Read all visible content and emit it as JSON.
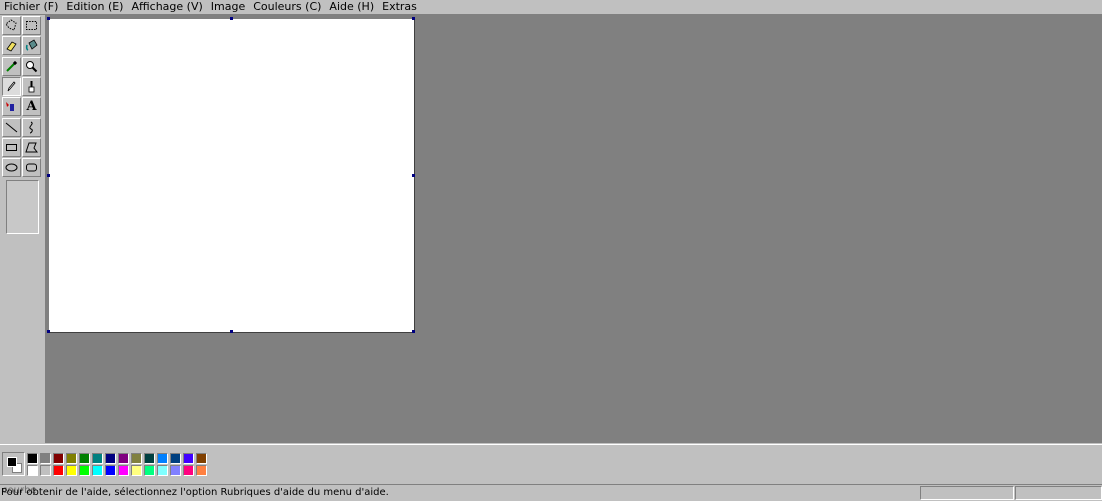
{
  "menu": [
    {
      "name": "file",
      "label": "Fichier",
      "key": "(F)"
    },
    {
      "name": "edit",
      "label": "Edition",
      "key": "(E)"
    },
    {
      "name": "view",
      "label": "Affichage",
      "key": "(V)"
    },
    {
      "name": "image",
      "label": "Image",
      "key": ""
    },
    {
      "name": "colors",
      "label": "Couleurs",
      "key": "(C)"
    },
    {
      "name": "help",
      "label": "Aide",
      "key": "(H)"
    },
    {
      "name": "extras",
      "label": "Extras",
      "key": ""
    }
  ],
  "tools": [
    {
      "name": "free-select",
      "icon": "free-select-icon"
    },
    {
      "name": "rect-select",
      "icon": "rect-select-icon"
    },
    {
      "name": "eraser",
      "icon": "eraser-icon"
    },
    {
      "name": "fill",
      "icon": "paint-bucket-icon"
    },
    {
      "name": "color-picker",
      "icon": "eyedropper-icon"
    },
    {
      "name": "magnifier",
      "icon": "magnifier-icon"
    },
    {
      "name": "pencil",
      "icon": "pencil-icon",
      "active": true
    },
    {
      "name": "brush",
      "icon": "brush-icon"
    },
    {
      "name": "airbrush",
      "icon": "airbrush-icon"
    },
    {
      "name": "text",
      "icon": "text-icon",
      "glyph": "A"
    },
    {
      "name": "line",
      "icon": "line-icon"
    },
    {
      "name": "curve",
      "icon": "curve-icon"
    },
    {
      "name": "rectangle",
      "icon": "rectangle-icon"
    },
    {
      "name": "polygon",
      "icon": "polygon-icon"
    },
    {
      "name": "ellipse",
      "icon": "ellipse-icon"
    },
    {
      "name": "rounded-rect",
      "icon": "rounded-rectangle-icon"
    }
  ],
  "colors": {
    "foreground": "#000000",
    "background": "#ffffff",
    "palette_top": [
      "#000000",
      "#808080",
      "#800000",
      "#808000",
      "#008000",
      "#008080",
      "#000080",
      "#800080",
      "#808040",
      "#004040",
      "#0080ff",
      "#004080",
      "#4000ff",
      "#804000"
    ],
    "palette_bottom": [
      "#ffffff",
      "#c0c0c0",
      "#ff0000",
      "#ffff00",
      "#00ff00",
      "#00ffff",
      "#0000ff",
      "#ff00ff",
      "#ffff80",
      "#00ff80",
      "#80ffff",
      "#8080ff",
      "#ff0080",
      "#ff8040"
    ]
  },
  "status": {
    "message": "Pour obtenir de l'aide, sélectionnez l'option Rubriques d'aide du menu d'aide.",
    "ghost": "courbe"
  }
}
